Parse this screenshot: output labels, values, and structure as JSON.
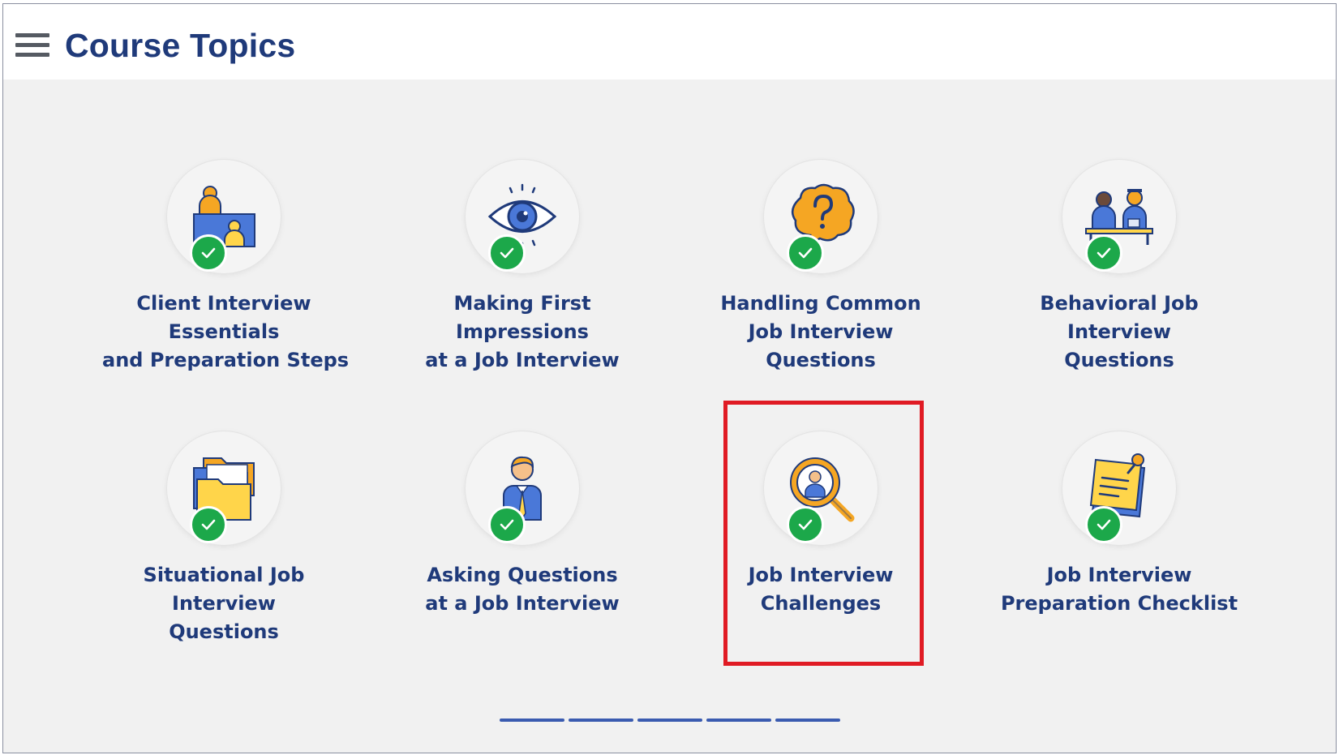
{
  "header": {
    "title": "Course Topics",
    "menu_icon": "hamburger-menu-icon"
  },
  "topics": [
    {
      "id": "client-interview-essentials",
      "lines": [
        "Client Interview",
        "Essentials",
        "and Preparation Steps"
      ],
      "icon": "client-desk-icon",
      "completed": true
    },
    {
      "id": "making-first-impressions",
      "lines": [
        "Making First",
        "Impressions",
        "at a Job Interview"
      ],
      "icon": "eye-icon",
      "completed": true
    },
    {
      "id": "handling-common-questions",
      "lines": [
        "Handling Common",
        "Job Interview",
        "Questions"
      ],
      "icon": "question-bubble-icon",
      "completed": true
    },
    {
      "id": "behavioral-questions",
      "lines": [
        "Behavioral Job",
        "Interview",
        "Questions"
      ],
      "icon": "interview-meeting-icon",
      "completed": true
    },
    {
      "id": "situational-questions",
      "lines": [
        "Situational Job",
        "Interview",
        "Questions"
      ],
      "icon": "folders-icon",
      "completed": true
    },
    {
      "id": "asking-questions",
      "lines": [
        "Asking Questions",
        "at a Job Interview"
      ],
      "icon": "businessman-icon",
      "completed": true
    },
    {
      "id": "interview-challenges",
      "lines": [
        "Job Interview",
        "Challenges"
      ],
      "icon": "magnifier-person-icon",
      "completed": true,
      "highlighted": true
    },
    {
      "id": "preparation-checklist",
      "lines": [
        "Job Interview",
        "Preparation Checklist"
      ],
      "icon": "pinned-note-icon",
      "completed": true
    }
  ],
  "pager": {
    "pages": 5
  },
  "colors": {
    "title": "#1f3a7a",
    "check_badge": "#1ca84a",
    "highlight": "#e01b24",
    "icon_blue": "#4a78d8",
    "icon_orange": "#f5a623",
    "icon_yellow": "#ffd54a"
  }
}
